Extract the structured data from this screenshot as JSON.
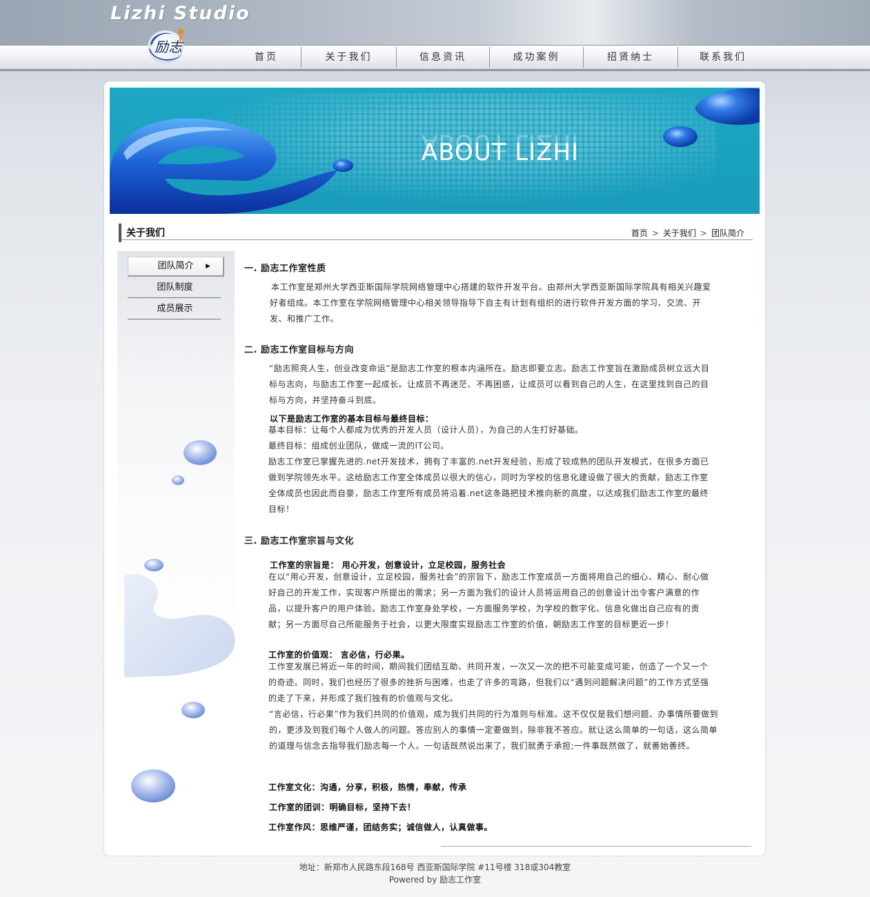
{
  "header": {
    "logo_text": "Lizhi Studio",
    "logo_glyphs": "励志"
  },
  "nav": {
    "items": [
      "首页",
      "关于我们",
      "信息资讯",
      "成功案例",
      "招贤纳士",
      "联系我们"
    ]
  },
  "banner": {
    "title": "ABOUT  LIZHI"
  },
  "section": {
    "title": "关于我们",
    "breadcrumb": [
      "首页",
      "关于我们",
      "团队简介"
    ]
  },
  "sidebar": {
    "items": [
      "团队简介",
      "团队制度",
      "成员展示"
    ],
    "active_index": 0
  },
  "content": {
    "s1_head": "一. 励志工作室性质",
    "s1_p1": "本工作室是郑州大学西亚斯国际学院网络管理中心搭建的软件开发平台。由郑州大学西亚斯国际学院具有相关兴趣爱好者组成。本工作室在学院网络管理中心相关领导指导下自主有计划有组织的进行软件开发方面的学习、交流、开发、和推广工作。",
    "s2_head": "二. 励志工作室目标与方向",
    "s2_p1": "“励志照亮人生，创业改变命运”是励志工作室的根本内涵所在。励志即要立志。励志工作室旨在激励成员树立远大目标与志向，与励志工作室一起成长。让成员不再迷茫、不再困惑，让成员可以看到自己的人生，在这里找到自己的目标与方向，并坚持奋斗到底。",
    "s2_b1": "以下是励志工作室的基本目标与最终目标：",
    "s2_l1": "基本目标：让每个人都成为优秀的开发人员（设计人员），为自己的人生打好基础。",
    "s2_l2": "最终目标：组成创业团队，做成一流的IT公司。",
    "s2_p2": "励志工作室已掌握先进的.net开发技术，拥有了丰富的.net开发经验，形成了较成熟的团队开发模式，在很多方面已做到学院领先水平。这给励志工作室全体成员以很大的信心，同时为学校的信息化建设做了很大的贡献，励志工作室全体成员也因此而自豪，励志工作室所有成员将沿着.net这条路把技术推向新的高度，以达成我们励志工作室的最终目标！",
    "s3_head": "三. 励志工作室宗旨与文化",
    "s3_b1": "工作室的宗旨是：  用心开发，创意设计，立足校园，服务社会",
    "s3_p1": "在以“用心开发，创意设计，立足校园，服务社会”的宗旨下，励志工作室成员一方面将用自己的细心、精心、耐心做好自己的开发工作，实现客户所提出的需求；另一方面为我们的设计人员将运用自己的创意设计出令客户满意的作品，以提升客户的用户体验。励志工作室身处学校，一方面服务学校，为学校的数字化、信息化做出自己应有的贡献；另一方面尽自己所能服务于社会，以更大限度实现励志工作室的价值，朝励志工作室的目标更近一步！",
    "s3_b2": "工作室的价值观：  言必信，行必果。",
    "s3_p2": "工作室发展已将近一年的时间，期间我们团结互助、共同开发，一次又一次的把不可能变成可能，创造了一个又一个的奇迹。同时，我们也经历了很多的挫折与困难，也走了许多的弯路，但我们以“遇到问题解决问题”的工作方式坚强的走了下来，并形成了我们独有的价值观与文化。",
    "s3_p3": "“言必信，行必果”作为我们共同的价值观，成为我们共同的行为准则与标准。这不仅仅是我们想问题、办事情所要做到的，更涉及到我们每个人做人的问题。答应别人的事情一定要做到，除非我不答应。就让这么简单的一句话，这么简单的道理与信念去指导我们励志每一个人。一句话既然说出来了，我们就勇于承担;一件事既然做了，就善始善终。",
    "s3_b3": "工作室文化：沟通，分享，积极，热情，奉献，传承",
    "s3_b4": "工作室的团训：明确目标，坚持下去！",
    "s3_b5": "工作室作风：思维严谨，团结务实；诚信做人，认真做事。"
  },
  "footer": {
    "address": "地址：新郑市人民路东段168号  西亚斯国际学院  #11号楼 318或304教室",
    "powered": "Powered by 励志工作室"
  },
  "colors": {
    "banner": "#1aa0bf",
    "drop_blue": "#1f63d6",
    "nav_border": "#8d96a3"
  }
}
